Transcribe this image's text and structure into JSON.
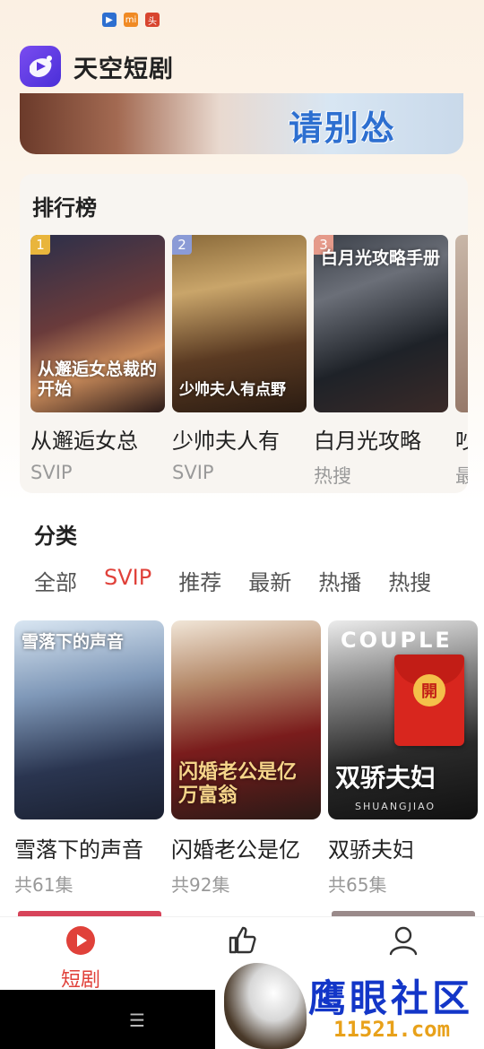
{
  "status_bar": {
    "left_icons": [
      "play-app-icon",
      "mi-app-icon",
      "news-app-icon"
    ]
  },
  "app": {
    "title": "天空短剧"
  },
  "banner": {
    "text": "请别怂"
  },
  "ranking": {
    "title": "排行榜",
    "items": [
      {
        "rank": "1",
        "name": "从邂逅女总",
        "tag": "SVIP",
        "poster_caption": "从邂逅女总裁的开始",
        "badge_color": "#e9b53c"
      },
      {
        "rank": "2",
        "name": "少帅夫人有",
        "tag": "SVIP",
        "poster_caption": "少帅夫人有点野",
        "badge_color": "#8b9bd6"
      },
      {
        "rank": "3",
        "name": "白月光攻略",
        "tag": "热搜",
        "poster_caption": "白月光攻略手册",
        "badge_color": "#e59a8a"
      },
      {
        "rank": "",
        "name": "吵",
        "tag": "最"
      }
    ]
  },
  "category": {
    "title": "分类",
    "filters": [
      "全部",
      "SVIP",
      "推荐",
      "最新",
      "热播",
      "热搜"
    ],
    "active_filter": "SVIP",
    "dramas": [
      {
        "name": "雪落下的声音",
        "count": "共61集",
        "poster_caption": "雪落下的声音"
      },
      {
        "name": "闪婚老公是亿",
        "count": "共92集",
        "poster_caption": "闪婚老公是亿万富翁"
      },
      {
        "name": "双骄夫妇",
        "count": "共65集",
        "poster_caption": "双骄夫妇",
        "poster_top_text": "COUPLE",
        "poster_bottom_text": "SHUANGJIAO",
        "red_packet_label": "開"
      }
    ]
  },
  "bottom_nav": {
    "items": [
      {
        "label": "短剧",
        "icon": "play-circle-icon"
      },
      {
        "label": "",
        "icon": "thumbs-up-icon"
      },
      {
        "label": "",
        "icon": "user-icon"
      }
    ]
  },
  "system_nav": {
    "menu_glyph": "☰"
  },
  "watermark": {
    "title": "鹰眼社区",
    "subtitle": "11521.com"
  },
  "colors": {
    "accent": "#e0413a",
    "brand": "#5a35e0"
  }
}
